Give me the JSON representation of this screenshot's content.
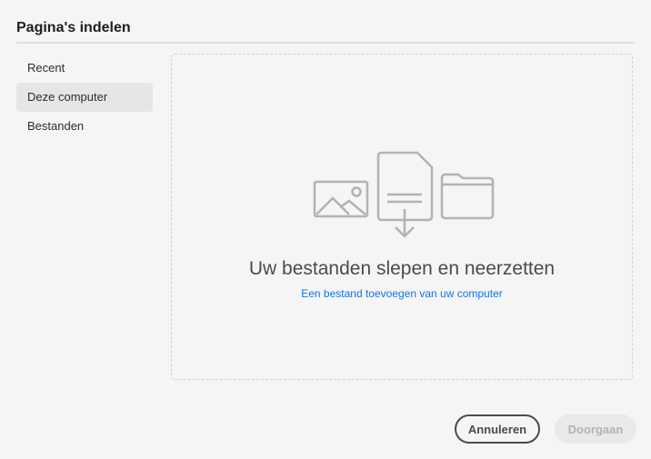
{
  "dialog": {
    "title": "Pagina's indelen"
  },
  "sidebar": {
    "items": [
      {
        "label": "Recent",
        "selected": false
      },
      {
        "label": "Deze computer",
        "selected": true
      },
      {
        "label": "Bestanden",
        "selected": false
      }
    ]
  },
  "dropzone": {
    "title": "Uw bestanden slepen en neerzetten",
    "link": "Een bestand toevoegen van uw computer",
    "icons": [
      "image-icon",
      "document-download-icon",
      "folder-icon"
    ]
  },
  "footer": {
    "cancel_label": "Annuleren",
    "continue_label": "Doorgaan",
    "continue_disabled": true
  },
  "colors": {
    "accent": "#1473e6",
    "background": "#f5f5f5",
    "selected": "#e6e6e6"
  }
}
